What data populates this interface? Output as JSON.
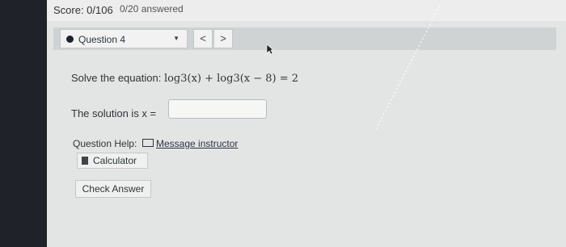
{
  "header": {
    "score": "Score: 0/106",
    "answered": "0/20 answered"
  },
  "question_nav": {
    "selected": "Question 4",
    "prev_label": "<",
    "next_label": ">"
  },
  "problem": {
    "prompt": "Solve the equation:",
    "equation": "log3(x) + log3(x − 8) = 2"
  },
  "answer": {
    "label": "The solution is x =",
    "value": ""
  },
  "help": {
    "label": "Question Help:",
    "message_link": "Message instructor",
    "calculator_label": "Calculator"
  },
  "actions": {
    "check_label": "Check Answer"
  }
}
